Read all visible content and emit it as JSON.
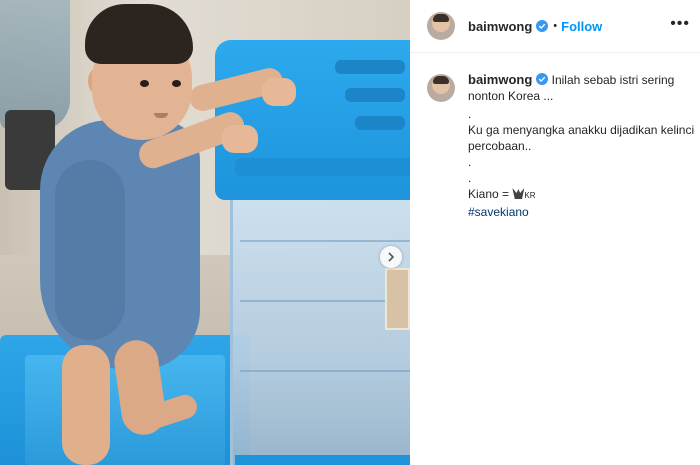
{
  "header": {
    "username": "baimwong",
    "separator": "•",
    "follow_label": "Follow",
    "more_label": "•••"
  },
  "caption": {
    "username": "baimwong",
    "line1": "Inilah sebab istri sering nonton Korea ...",
    "line2": ".",
    "line3": "Ku ga menyangka anakku dijadikan kelinci percobaan..",
    "line4": ".",
    "line5": ".",
    "line6_prefix": "Kiano = ",
    "line6_flag_text": "KR",
    "hashtag": "#savekiano"
  },
  "icons": {
    "verified": "verified-badge-icon",
    "next": "chevron-right-icon",
    "more": "more-options-icon"
  },
  "colors": {
    "follow": "#0095f6",
    "hashtag": "#00376b",
    "verified": "#3897f0"
  }
}
